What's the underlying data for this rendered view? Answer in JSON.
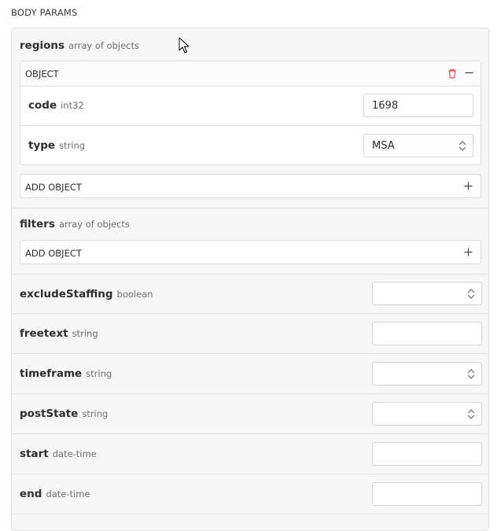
{
  "section_title": "BODY PARAMS",
  "params": {
    "regions": {
      "name": "regions",
      "type": "array of objects",
      "object": {
        "header": "OBJECT",
        "fields": [
          {
            "name": "code",
            "type": "int32",
            "value": "1698"
          },
          {
            "name": "type",
            "type": "string",
            "value": "MSA"
          }
        ]
      },
      "add_label": "ADD OBJECT"
    },
    "filters": {
      "name": "filters",
      "type": "array of objects",
      "add_label": "ADD OBJECT"
    },
    "excludeStaffing": {
      "name": "excludeStaffing",
      "type": "boolean",
      "value": ""
    },
    "freetext": {
      "name": "freetext",
      "type": "string",
      "value": ""
    },
    "timeframe": {
      "name": "timeframe",
      "type": "string",
      "value": ""
    },
    "postState": {
      "name": "postState",
      "type": "string",
      "value": ""
    },
    "start": {
      "name": "start",
      "type": "date-time",
      "value": ""
    },
    "end": {
      "name": "end",
      "type": "date-time",
      "value": ""
    }
  },
  "icons": {
    "delete": "trash-icon",
    "collapse": "minus-icon",
    "add": "plus-icon",
    "select": "chevron-updown-icon",
    "cursor": "mouse-pointer-icon"
  },
  "colors": {
    "delete_icon": "#e04c4c",
    "panel_bg": "#f7f7f7",
    "border": "#dedede"
  }
}
